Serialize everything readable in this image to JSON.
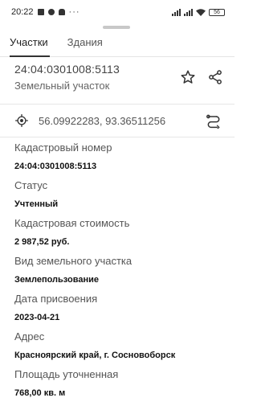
{
  "status_bar": {
    "time": "20:22",
    "more": "···",
    "battery": "56"
  },
  "tabs": [
    {
      "label": "Участки"
    },
    {
      "label": "Здания"
    }
  ],
  "header": {
    "number": "24:04:0301008:5113",
    "type": "Земельный участок"
  },
  "coordinates": "56.09922283, 93.36511256",
  "fields": [
    {
      "label": "Кадастровый номер",
      "value": "24:04:0301008:5113"
    },
    {
      "label": "Статус",
      "value": "Учтенный"
    },
    {
      "label": "Кадастровая стоимость",
      "value": "2 987,52 руб."
    },
    {
      "label": "Вид земельного участка",
      "value": "Землепользование"
    },
    {
      "label": "Дата присвоения",
      "value": "2023-04-21"
    },
    {
      "label": "Адрес",
      "value": "Красноярский край, г. Сосновоборск"
    },
    {
      "label": "Площадь уточненная",
      "value": "768,00 кв. м"
    }
  ]
}
